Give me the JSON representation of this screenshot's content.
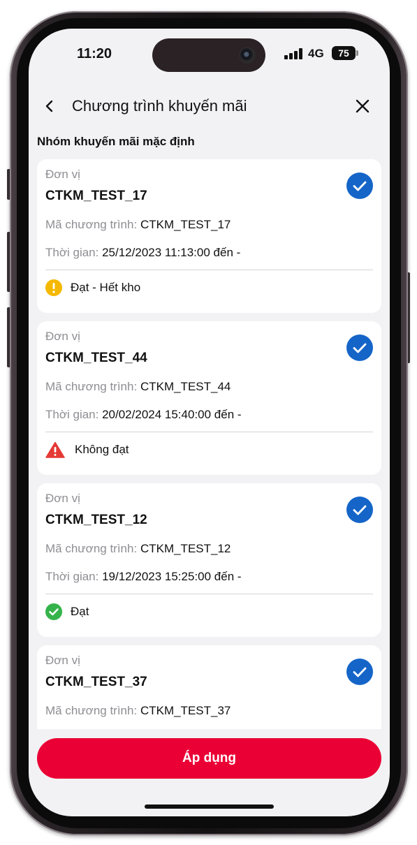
{
  "status_bar": {
    "time": "11:20",
    "network": "4G",
    "battery": "75"
  },
  "header": {
    "title": "Chương trình khuyến mãi"
  },
  "section": {
    "title": "Nhóm khuyến mãi mặc định"
  },
  "cards": [
    {
      "unit_label": "Đơn vị",
      "code": "CTKM_TEST_17",
      "program_label": "Mã chương trình:",
      "program_value": "CTKM_TEST_17",
      "time_label": "Thời gian:",
      "time_value": "25/12/2023 11:13:00 đến -",
      "status": "Đạt - Hết kho",
      "status_icon": "warning-circle-icon"
    },
    {
      "unit_label": "Đơn vị",
      "code": "CTKM_TEST_44",
      "program_label": "Mã chương trình:",
      "program_value": "CTKM_TEST_44",
      "time_label": "Thời gian:",
      "time_value": "20/02/2024 15:40:00 đến -",
      "status": "Không đạt",
      "status_icon": "alert-triangle-icon"
    },
    {
      "unit_label": "Đơn vị",
      "code": "CTKM_TEST_12",
      "program_label": "Mã chương trình:",
      "program_value": "CTKM_TEST_12",
      "time_label": "Thời gian:",
      "time_value": "19/12/2023 15:25:00 đến -",
      "status": "Đạt",
      "status_icon": "success-check-icon"
    },
    {
      "unit_label": "Đơn vị",
      "code": "CTKM_TEST_37",
      "program_label": "Mã chương trình:",
      "program_value": "CTKM_TEST_37"
    }
  ],
  "apply_button": {
    "label": "Áp dụng"
  },
  "colors": {
    "primary": "#1565c8",
    "apply": "#ea0034",
    "warning": "#f5b800",
    "danger": "#e53935",
    "success": "#34b34a"
  }
}
